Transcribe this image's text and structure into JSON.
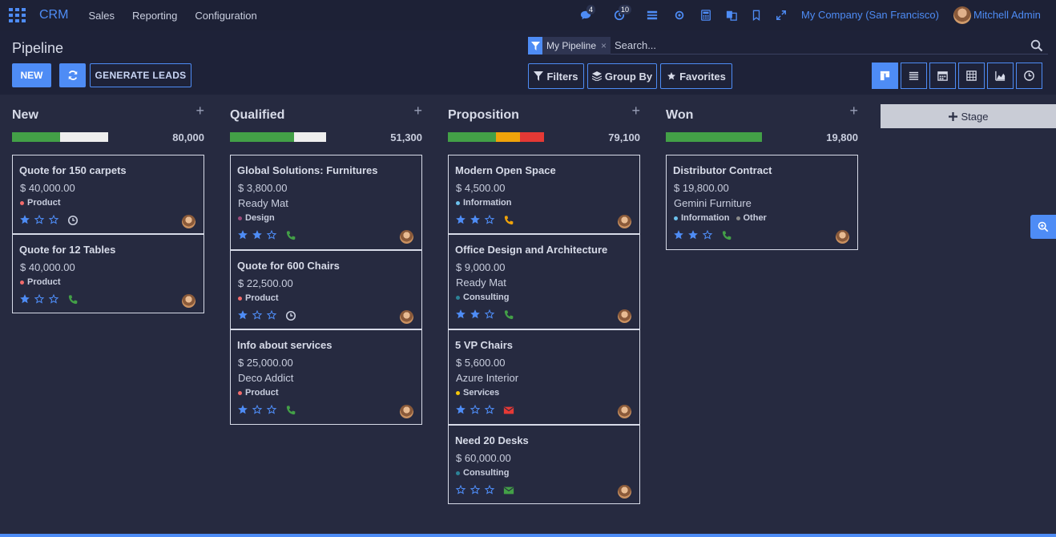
{
  "navbar": {
    "brand": "CRM",
    "menus": [
      "Sales",
      "Reporting",
      "Configuration"
    ],
    "messages_count": "4",
    "activities_count": "10",
    "company": "My Company (San Francisco)",
    "user": "Mitchell Admin"
  },
  "control_panel": {
    "breadcrumb": "Pipeline",
    "new_label": "NEW",
    "generate_label": "GENERATE LEADS",
    "search_facet": "My Pipeline",
    "search_facet_remove": "×",
    "search_placeholder": "Search...",
    "filters_label": "Filters",
    "groupby_label": "Group By",
    "favorites_label": "Favorites",
    "views": [
      "kanban",
      "list",
      "calendar",
      "pivot",
      "graph",
      "activity"
    ],
    "active_view": "kanban"
  },
  "colors": {
    "accent": "#4e8cf5",
    "progress_green": "#43a047",
    "progress_orange": "#f0a30a",
    "progress_red": "#e53935",
    "progress_empty": "#eeeeee"
  },
  "add_stage_label": "Stage",
  "columns": [
    {
      "title": "New",
      "total": "80,000",
      "progress": [
        {
          "color": "#43a047",
          "fraction": 0.5
        },
        {
          "color": "#eeeeee",
          "fraction": 0.5
        }
      ],
      "cards": [
        {
          "title": "Quote for 150 carpets",
          "amount": "$ 40,000.00",
          "company": "",
          "tags": [
            {
              "name": "Product",
              "color": "#f26b6b"
            }
          ],
          "stars": 1,
          "activity": "clock-icon",
          "activity_color": "#c9cede"
        },
        {
          "title": "Quote for 12 Tables",
          "amount": "$ 40,000.00",
          "company": "",
          "tags": [
            {
              "name": "Product",
              "color": "#f26b6b"
            }
          ],
          "stars": 1,
          "activity": "phone-icon",
          "activity_color": "#43a047"
        }
      ]
    },
    {
      "title": "Qualified",
      "total": "51,300",
      "progress": [
        {
          "color": "#43a047",
          "fraction": 0.67
        },
        {
          "color": "#eeeeee",
          "fraction": 0.33
        }
      ],
      "cards": [
        {
          "title": "Global Solutions: Furnitures",
          "amount": "$ 3,800.00",
          "company": "Ready Mat",
          "tags": [
            {
              "name": "Design",
              "color": "#9c4a7a"
            }
          ],
          "stars": 2,
          "activity": "phone-icon",
          "activity_color": "#43a047"
        },
        {
          "title": "Quote for 600 Chairs",
          "amount": "$ 22,500.00",
          "company": "",
          "tags": [
            {
              "name": "Product",
              "color": "#f26b6b"
            }
          ],
          "stars": 1,
          "activity": "clock-icon",
          "activity_color": "#c9cede"
        },
        {
          "title": "Info about services",
          "amount": "$ 25,000.00",
          "company": "Deco Addict",
          "tags": [
            {
              "name": "Product",
              "color": "#f26b6b"
            }
          ],
          "stars": 1,
          "activity": "phone-icon",
          "activity_color": "#43a047"
        }
      ]
    },
    {
      "title": "Proposition",
      "total": "79,100",
      "progress": [
        {
          "color": "#43a047",
          "fraction": 0.5
        },
        {
          "color": "#f0a30a",
          "fraction": 0.25
        },
        {
          "color": "#e53935",
          "fraction": 0.25
        }
      ],
      "cards": [
        {
          "title": "Modern Open Space",
          "amount": "$ 4,500.00",
          "company": "",
          "tags": [
            {
              "name": "Information",
              "color": "#6cc1ed"
            }
          ],
          "stars": 2,
          "activity": "phone-icon",
          "activity_color": "#f0a30a"
        },
        {
          "title": "Office Design and Architecture",
          "amount": "$ 9,000.00",
          "company": "Ready Mat",
          "tags": [
            {
              "name": "Consulting",
              "color": "#2c8397"
            }
          ],
          "stars": 2,
          "activity": "phone-icon",
          "activity_color": "#43a047"
        },
        {
          "title": "5 VP Chairs",
          "amount": "$ 5,600.00",
          "company": "Azure Interior",
          "tags": [
            {
              "name": "Services",
              "color": "#f4c609"
            }
          ],
          "stars": 1,
          "activity": "envelope-icon",
          "activity_color": "#e53935"
        },
        {
          "title": "Need 20 Desks",
          "amount": "$ 60,000.00",
          "company": "",
          "tags": [
            {
              "name": "Consulting",
              "color": "#2c8397"
            }
          ],
          "stars": 0,
          "activity": "envelope-icon",
          "activity_color": "#43a047"
        }
      ]
    },
    {
      "title": "Won",
      "total": "19,800",
      "progress": [
        {
          "color": "#43a047",
          "fraction": 1.0
        }
      ],
      "cards": [
        {
          "title": "Distributor Contract",
          "amount": "$ 19,800.00",
          "company": "Gemini Furniture",
          "tags": [
            {
              "name": "Information",
              "color": "#6cc1ed"
            },
            {
              "name": "Other",
              "color": "#8a8a8a"
            }
          ],
          "stars": 2,
          "activity": "phone-icon",
          "activity_color": "#43a047"
        }
      ]
    }
  ]
}
